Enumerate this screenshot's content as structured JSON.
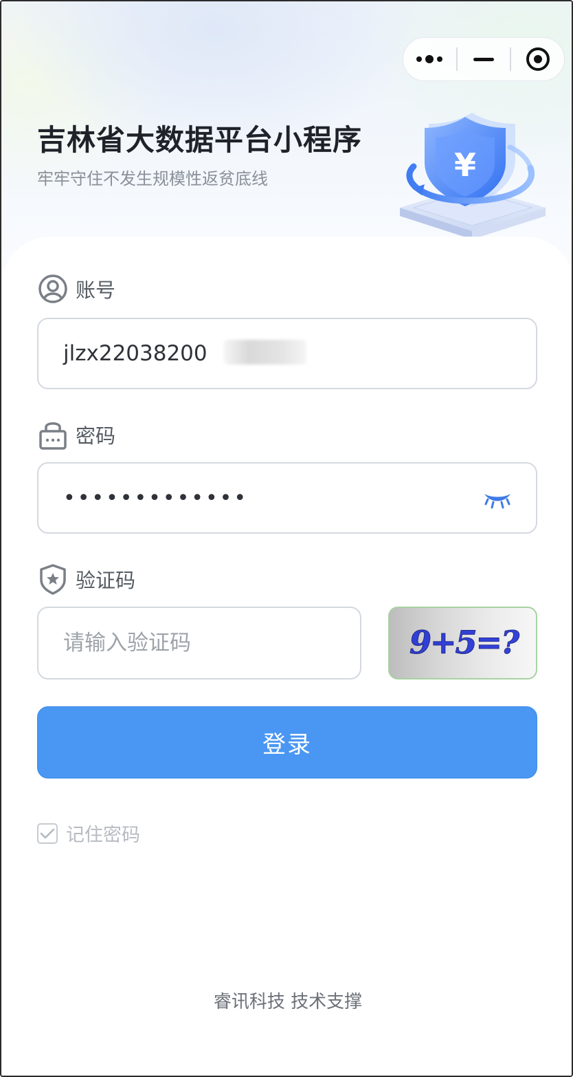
{
  "capsule": {
    "more": "more-icon",
    "minimize": "minimize-icon",
    "close": "target-icon"
  },
  "header": {
    "title": "吉林省大数据平台小程序",
    "subtitle": "牢牢守住不发生规模性返贫底线"
  },
  "account": {
    "label": "账号",
    "value": "jlzx22038200",
    "icon": "user-icon"
  },
  "password": {
    "label": "密码",
    "masked_value": "•••••••••••••",
    "icon": "lock-icon",
    "toggle_icon": "eye-closed-icon"
  },
  "captcha": {
    "label": "验证码",
    "placeholder": "请输入验证码",
    "image_text": "9+5=?",
    "icon": "shield-star-icon"
  },
  "login_button": {
    "label": "登录",
    "color": "#4a97f3"
  },
  "remember": {
    "label": "记住密码",
    "checked": true
  },
  "footer": {
    "text": "睿讯科技 技术支撑"
  }
}
